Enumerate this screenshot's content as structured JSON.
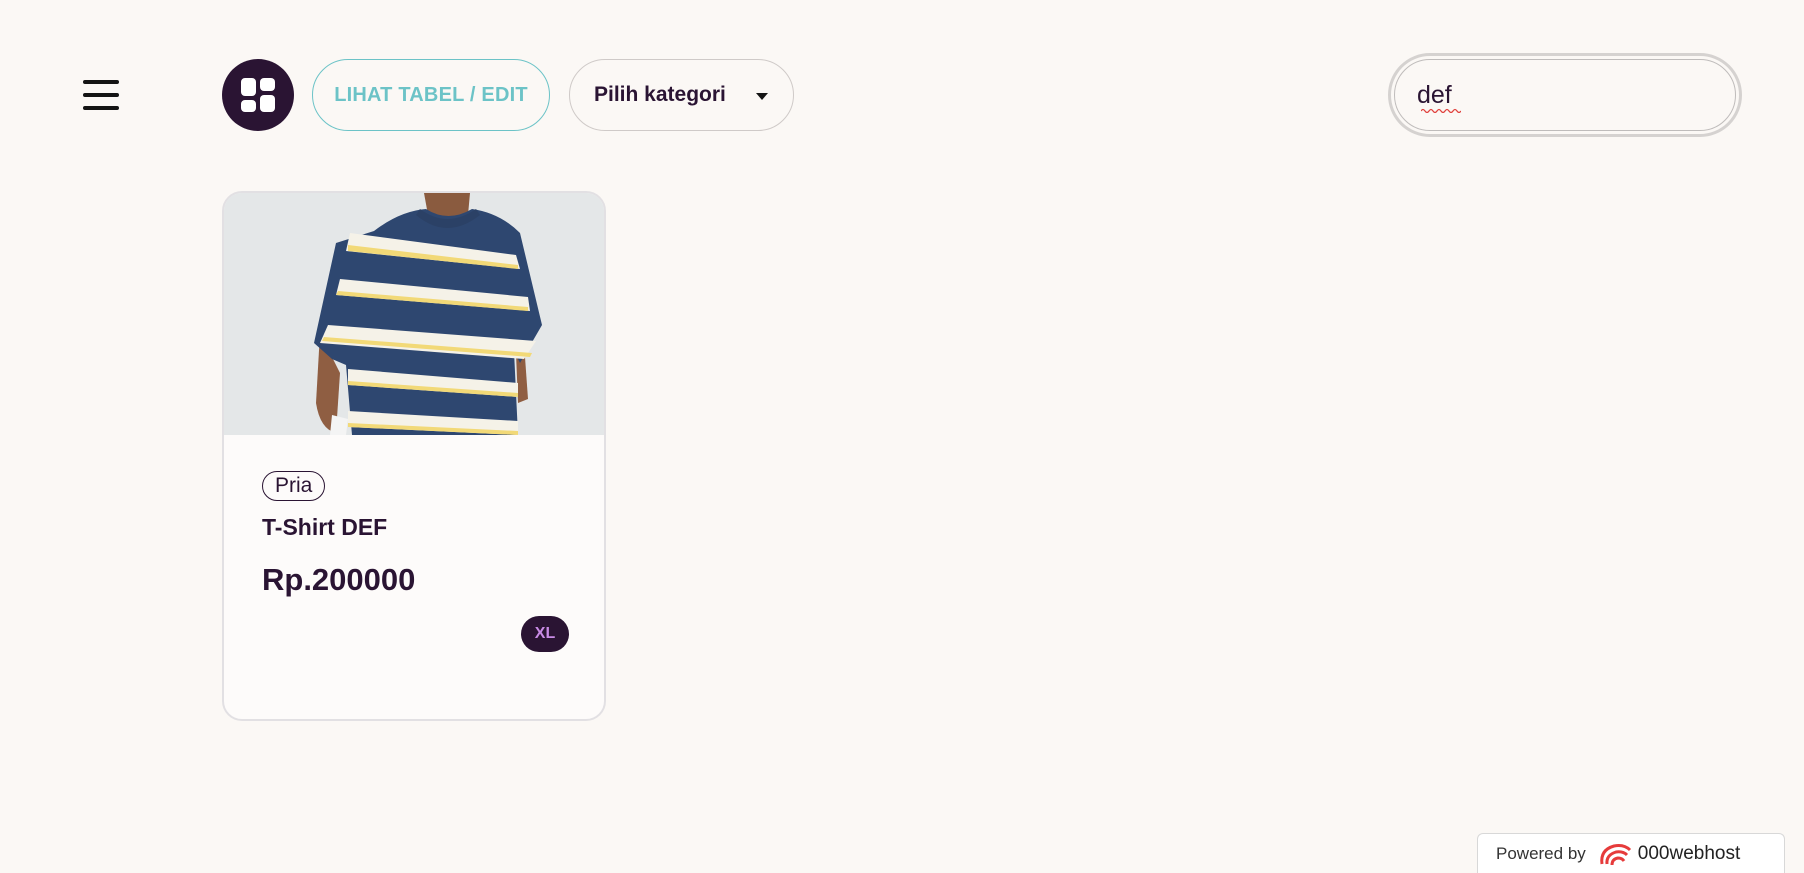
{
  "header": {
    "menu_icon": "hamburger-menu-icon",
    "view_icon": "grid-view-icon",
    "table_edit_label": "LIHAT TABEL / EDIT",
    "category_select": {
      "selected": "Pilih kategori",
      "icon": "caret-down-icon"
    },
    "search": {
      "value": "def"
    }
  },
  "products": [
    {
      "image": "striped-tshirt-photo",
      "category": "Pria",
      "name": "T-Shirt DEF",
      "price": "Rp.200000",
      "size": "XL"
    }
  ],
  "footer": {
    "powered_by": "Powered by",
    "brand": "000webhost",
    "brand_icon": "000webhost-logo-icon"
  },
  "colors": {
    "background": "#fbf8f5",
    "primary_dark": "#2a1433",
    "accent_teal": "#6cc3c7",
    "size_badge_text": "#c98be6",
    "brand_red": "#e63b3b"
  }
}
